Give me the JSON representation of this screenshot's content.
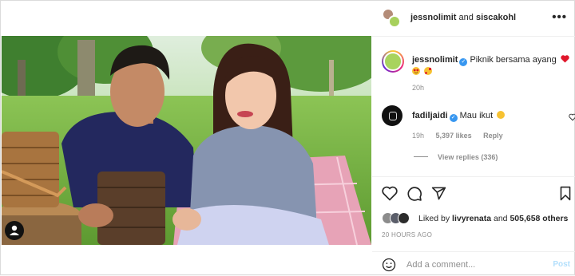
{
  "header": {
    "user1": "jessnolimit",
    "and_text": "and",
    "user2": "siscakohl",
    "more_label": "•••"
  },
  "caption": {
    "username": "jessnolimit",
    "text": "Piknik bersama ayang",
    "time": "20h"
  },
  "comment": {
    "username": "fadiljaidi",
    "text": "Mau ikut",
    "time": "19h",
    "likes": "5,397 likes",
    "reply": "Reply"
  },
  "view_replies": "View replies (336)",
  "liked_by": {
    "prefix": "Liked by",
    "user": "livyrenata",
    "middle": "and",
    "others": "505,658 others"
  },
  "post_age": "20 HOURS AGO",
  "add_comment": {
    "placeholder": "Add a comment...",
    "post_label": "Post"
  },
  "colors": {
    "verified": "#3897f0",
    "secondary_text": "#8e8e8e",
    "post_disabled": "#b2dffc",
    "heart": "#ed4956"
  }
}
